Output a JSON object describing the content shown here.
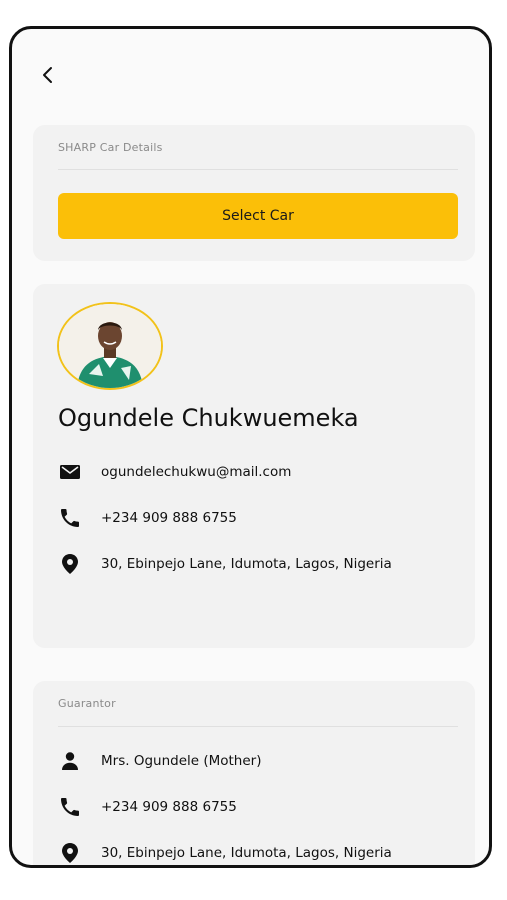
{
  "car_section": {
    "label": "SHARP Car Details",
    "select_button": "Select Car"
  },
  "profile": {
    "name": "Ogundele Chukwuemeka",
    "email": "ogundelechukwu@mail.com",
    "phone": "+234 909 888 6755",
    "address": "30, Ebinpejo Lane, Idumota, Lagos, Nigeria"
  },
  "guarantor": {
    "label": "Guarantor",
    "name": "Mrs. Ogundele (Mother)",
    "phone": "+234 909 888 6755",
    "address": "30, Ebinpejo Lane, Idumota, Lagos, Nigeria"
  },
  "colors": {
    "accent": "#fbbf08",
    "avatar_border": "#f2c21a",
    "card_background": "#f2f2f2"
  },
  "icons": {
    "back": "chevron-left-icon",
    "email": "mail-icon",
    "phone": "phone-icon",
    "location": "location-pin-icon",
    "person": "person-icon"
  }
}
